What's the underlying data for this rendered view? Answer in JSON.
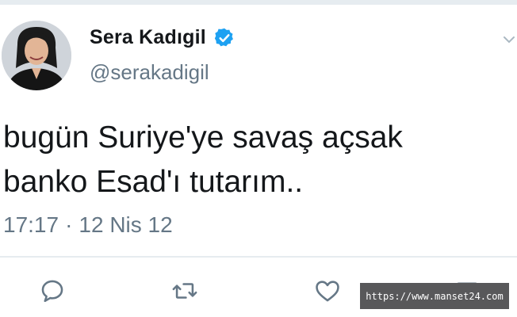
{
  "tweet": {
    "display_name": "Sera Kadıgil",
    "handle": "@serakadigil",
    "text": "bugün Suriye'ye savaş açsak\nbanko Esad'ı tutarım..",
    "time": "17:17",
    "separator": "·",
    "date": "12 Nis 12",
    "verified": true
  },
  "icons": {
    "avatar": "profile-photo",
    "verified": "verified-badge-icon",
    "menu": "chevron-down-icon",
    "reply": "reply-icon",
    "retweet": "retweet-icon",
    "like": "heart-icon",
    "share": "share-icon"
  },
  "colors": {
    "text_primary": "#14171a",
    "text_secondary": "#657786",
    "verified_blue": "#1da1f2",
    "divider": "#e6ecf0",
    "watermark_bg": "#58585a"
  },
  "watermark": {
    "text": "https://www.manset24.com"
  }
}
